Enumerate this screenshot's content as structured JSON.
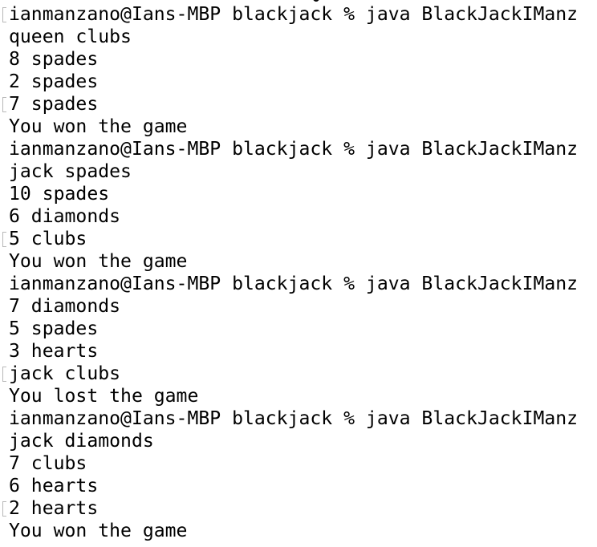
{
  "terminal": {
    "lines": [
      {
        "text": "ianmanzano@Ians-MBP blackjack % java BlackJackIManz",
        "kind": "prompt",
        "marked": true
      },
      {
        "text": "queen clubs",
        "kind": "output",
        "marked": false
      },
      {
        "text": "8 spades",
        "kind": "output",
        "marked": false
      },
      {
        "text": "2 spades",
        "kind": "output",
        "marked": false
      },
      {
        "text": "7 spades",
        "kind": "output",
        "marked": true
      },
      {
        "text": "You won the game",
        "kind": "result",
        "marked": false
      },
      {
        "text": "ianmanzano@Ians-MBP blackjack % java BlackJackIManz",
        "kind": "prompt",
        "marked": false
      },
      {
        "text": "jack spades",
        "kind": "output",
        "marked": false
      },
      {
        "text": "10 spades",
        "kind": "output",
        "marked": false
      },
      {
        "text": "6 diamonds",
        "kind": "output",
        "marked": false
      },
      {
        "text": "5 clubs",
        "kind": "output",
        "marked": true
      },
      {
        "text": "You won the game",
        "kind": "result",
        "marked": false
      },
      {
        "text": "ianmanzano@Ians-MBP blackjack % java BlackJackIManz",
        "kind": "prompt",
        "marked": false
      },
      {
        "text": "7 diamonds",
        "kind": "output",
        "marked": false
      },
      {
        "text": "5 spades",
        "kind": "output",
        "marked": false
      },
      {
        "text": "3 hearts",
        "kind": "output",
        "marked": false
      },
      {
        "text": "jack clubs",
        "kind": "output",
        "marked": true
      },
      {
        "text": "You lost the game",
        "kind": "result",
        "marked": false
      },
      {
        "text": "ianmanzano@Ians-MBP blackjack % java BlackJackIManz",
        "kind": "prompt",
        "marked": false
      },
      {
        "text": "jack diamonds",
        "kind": "output",
        "marked": false
      },
      {
        "text": "7 clubs",
        "kind": "output",
        "marked": false
      },
      {
        "text": "6 hearts",
        "kind": "output",
        "marked": false
      },
      {
        "text": "2 hearts",
        "kind": "output",
        "marked": true
      },
      {
        "text": "You won the game",
        "kind": "result",
        "marked": false
      }
    ],
    "colors": {
      "background": "#ffffff",
      "text": "#000000",
      "mark": "#b8b8b8"
    }
  }
}
